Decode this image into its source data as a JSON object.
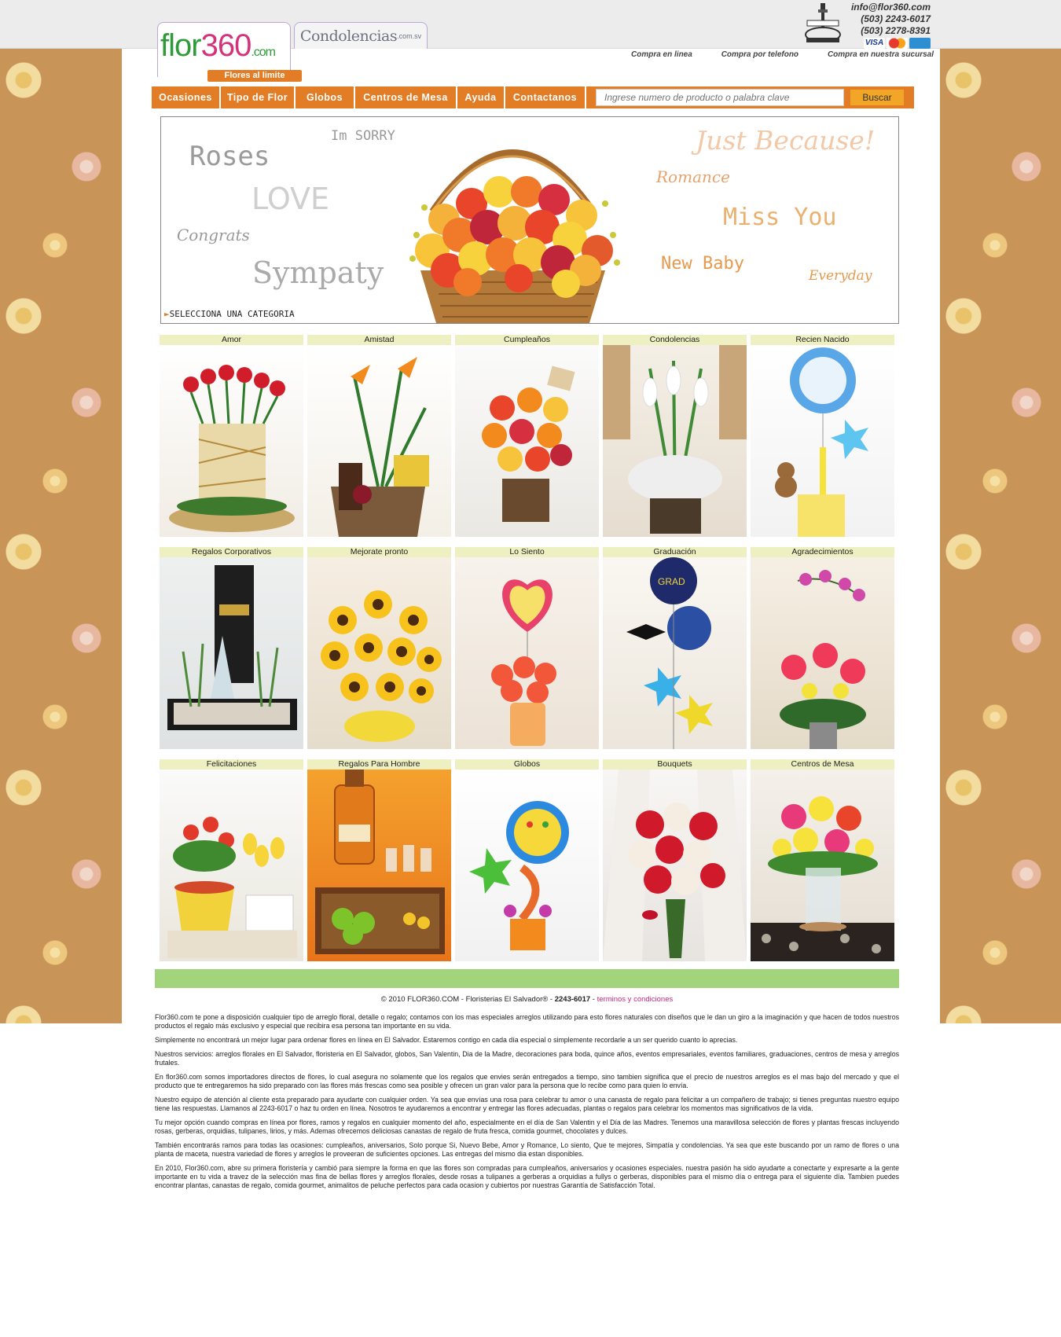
{
  "header": {
    "logo_text_a": "flor",
    "logo_text_b": "360",
    "logo_text_c": ".com",
    "logo_tagline": "Flores al limite",
    "sister_site": "Condolencias",
    "sister_site_suffix": ".com.sv",
    "email": "info@flor360.com",
    "phone_1": "(503) 2243-6017",
    "phone_2": "(503) 2278-8391",
    "cards": [
      "VISA",
      "MasterCard",
      "AMERICAN EXPRESS"
    ],
    "buy_modes": [
      "Compra en linea",
      "Compra por telefono",
      "Compra en nuestra sucursal"
    ]
  },
  "nav": {
    "items": [
      "Ocasiones",
      "Tipo de Flor",
      "Globos",
      "Centros de Mesa",
      "Ayuda",
      "Contactanos"
    ],
    "search_placeholder": "Ingrese numero de producto o palabra clave",
    "search_button": "Buscar"
  },
  "banner": {
    "words": [
      "Roses",
      "Im SORRY",
      "LOVE",
      "Congrats",
      "Sympaty",
      "Just Because!",
      "Romance",
      "Miss You",
      "New Baby",
      "Everyday"
    ],
    "cta": "SELECCIONA UNA CATEGORIA"
  },
  "categories": [
    "Amor",
    "Amistad",
    "Cumpleaños",
    "Condolencias",
    "Recien Nacido",
    "Regalos Corporativos",
    "Mejorate pronto",
    "Lo Siento",
    "Graduación",
    "Agradecimientos",
    "Felicitaciones",
    "Regalos Para Hombre",
    "Globos",
    "Bouquets",
    "Centros de Mesa"
  ],
  "footer": {
    "copyright": "© 2010 FLOR360.COM - Floristerias El Salvador® -",
    "phone": "2243-6017",
    "dash": "-",
    "terms": "terminos y condiciones",
    "paragraphs": [
      "Flor360.com te pone a disposición cualquier tipo de arreglo floral, detalle o regalo; contamos con los mas especiales arreglos utilizando para esto flores  naturales con diseños que le dan un giro a la imaginación y que hacen de todos nuestros productos el regalo más exclusivo y especial que recibira esa persona tan importante en su vida.",
      "Simplemente no encontrará un mejor lugar para ordenar flores en línea en El Salvador. Estaremos contigo en cada día especial o simplemente recordarle a un ser querido cuanto lo aprecias.",
      "Nuestros servicios: arreglos florales en El Salvador, floristeria en El Salvador, globos, San Valentin, Dia de la Madre, decoraciones para boda, quince años, eventos empresariales, eventos familiares, graduaciones, centros de mesa y arreglos frutales.",
      "En flor360.com somos importadores directos de flores, lo cual asegura no solamente  que los regalos que envies serán entregados a tiempo, sino tambien significa que el precio de nuestros arreglos es el mas bajo del mercado y que el producto que te entregaremos ha sido preparado con las flores más frescas como sea posible  y ofrecen un gran valor para la persona que lo recibe como para quien lo envía.",
      "Nuestro equipo de atención al cliente esta preparado para ayudarte con cualquier orden. Ya sea que envías una  rosa para celebrar tu amor o una canasta de regalo para felicitar a un compañero de trabajo; si tienes preguntas nuestro equipo tiene las respuestas. Llamanos al 2243-6017 o haz tu orden en línea. Nosotros te ayudaremos a encontrar y entregar las flores adecuadas, plantas o regalos para celebrar los momentos mas significativos de la vida.",
      "Tu mejor opción cuando compras en línea por flores, ramos y regalos en cualquier momento del año, especialmente en el día de San Valentin y el Día de las Madres. Tenemos una maravillosa selección de flores y plantas frescas incluyendo rosas, gerberas, orquidias, tulipanes, lirios, y más. Ademas ofrecemos deliciosas canastas de regalo de fruta fresca, comida gourmet, chocolates y dulces.",
      "También encontrarás ramos para todas las ocasiones: cumpleaños, aniversarios, Solo porque Si, Nuevo Bebe, Amor y Romance, Lo siento, Que te mejores, Simpatía y condolencias.  Ya sea que este buscando por un ramo de flores o una planta de maceta, nuestra variedad de flores y arreglos le proveeran de suficientes opciones. Las entregas del mismo dia estan disponibles.",
      "En 2010, Flor360.com, abre su primera floristería y cambió para siempre la forma en que las flores son compradas para cumpleaños, aniversarios y ocasiones especiales. nuestra pasión ha sido ayudarte a conectarte y expresarte a la gente importante en tu vida a travez de la selección mas fina de bellas flores y arreglos florales, desde rosas a tulipanes a gerberas a orquidias a fullys o gerberas, disponibles para el mismo día o entrega para el siguiente día. Tambien puedes encontrar plantas, canastas de regalo, comida gourmet, animalitos de peluche perfectos para cada ocasion y cubiertos por nuestras Garantía de Satisfacción Total."
    ]
  },
  "colors": {
    "nav_orange": "#e37d25",
    "brand_green": "#2f9a3a",
    "brand_pink": "#d4337b",
    "label_bg": "#eef0c2",
    "footer_bar": "#a2d47b"
  }
}
